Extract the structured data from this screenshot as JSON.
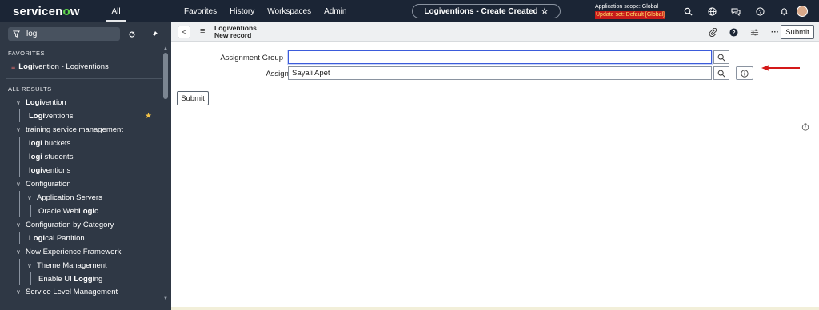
{
  "topbar": {
    "logo_pre": "servicen",
    "logo_o": "o",
    "logo_post": "w",
    "all_label": "All",
    "nav": [
      "Favorites",
      "History",
      "Workspaces",
      "Admin"
    ],
    "context_title": "Logiventions - Create Created",
    "scope_line1": "Application scope: Global",
    "scope_line2": "Update set: Default [Global]",
    "colors": {
      "bg": "#1b2535",
      "accent_green": "#62d84e",
      "update_set_bg": "#c81b1b"
    }
  },
  "sidebar": {
    "filter_value": "logi",
    "favorites_heading": "FAVORITES",
    "favorite_item": {
      "bold": "Logi",
      "rest": "vention - Logiventions"
    },
    "all_results_heading": "ALL RESULTS",
    "items": [
      {
        "pre": "",
        "bold": "Logi",
        "post": "vention"
      },
      {
        "pre": "",
        "bold": "Logi",
        "post": "ventions"
      },
      {
        "pre": "",
        "bold": "",
        "post": "training service management"
      },
      {
        "pre": "",
        "bold": "logi",
        "post": " buckets"
      },
      {
        "pre": "",
        "bold": "logi",
        "post": " students"
      },
      {
        "pre": "",
        "bold": "logi",
        "post": "ventions"
      },
      {
        "pre": "",
        "bold": "",
        "post": "Configuration"
      },
      {
        "pre": "",
        "bold": "",
        "post": "Application Servers"
      },
      {
        "pre": "Oracle Web",
        "bold": "Logi",
        "post": "c"
      },
      {
        "pre": "",
        "bold": "",
        "post": "Configuration by Category"
      },
      {
        "pre": "",
        "bold": "Logi",
        "post": "cal Partition"
      },
      {
        "pre": "",
        "bold": "",
        "post": "Now Experience Framework"
      },
      {
        "pre": "",
        "bold": "",
        "post": "Theme Management"
      },
      {
        "pre": "Enable UI ",
        "bold": "Logg",
        "post": "ing"
      },
      {
        "pre": "",
        "bold": "",
        "post": "Service Level Management"
      }
    ]
  },
  "record": {
    "title_line1": "Logiventions",
    "title_line2": "New record",
    "submit_label": "Submit",
    "fields": {
      "assignment_group_label": "Assignment Group",
      "assignment_group_value": "",
      "assigned_to_label": "Assigned to",
      "assigned_to_value": "Sayali Apet"
    },
    "bottom_submit_label": "Submit"
  },
  "annotation": {
    "color": "#d41919"
  }
}
